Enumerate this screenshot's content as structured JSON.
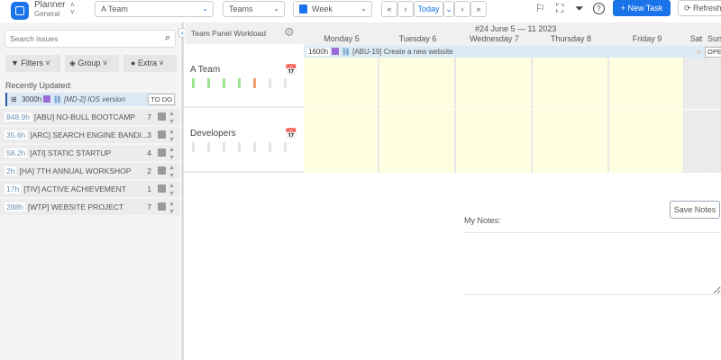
{
  "header": {
    "app_title": "Planner",
    "app_subtitle": "General",
    "team_select": "A Team",
    "view_select": "Teams",
    "period_select": "Week",
    "today_label": "Today",
    "new_task_label": "+ New Task",
    "refresh_label": "Refresh"
  },
  "sidebar": {
    "search_placeholder": "Search issues",
    "filters_label": "Filters",
    "group_label": "Group",
    "extra_label": "Extra",
    "recent_label": "Recently Updated:",
    "recent_item": {
      "hours": "3000h",
      "title": "[MD-2] IOS version",
      "status": "TO DO"
    },
    "projects": [
      {
        "hours": "848.9h",
        "name": "[ABU] NO-BULL BOOTCAMP",
        "count": "7"
      },
      {
        "hours": "35.6h",
        "name": "[ARC] SEARCH ENGINE BANDI...",
        "count": "3"
      },
      {
        "hours": "58.2h",
        "name": "[ATI] STATIC STARTUP",
        "count": "4"
      },
      {
        "hours": "2h",
        "name": "[HA] 7TH ANNUAL WORKSHOP",
        "count": "2"
      },
      {
        "hours": "17h",
        "name": "[TIV] ACTIVE ACHIEVEMENT",
        "count": "1"
      },
      {
        "hours": "288h",
        "name": "[WTP] WEBSITE PROJECT",
        "count": "7"
      }
    ]
  },
  "team_panel": {
    "title": "Team Panel Workload",
    "teams": [
      {
        "name": "A Team",
        "workload": [
          "#9be58f",
          "#9be58f",
          "#9be58f",
          "#9be58f",
          "#f0a070",
          "#e4e4e4",
          "#e4e4e4"
        ]
      },
      {
        "name": "Developers",
        "workload": [
          "#e4e4e4",
          "#e4e4e4",
          "#e4e4e4",
          "#e4e4e4",
          "#e4e4e4",
          "#e4e4e4",
          "#e4e4e4"
        ]
      }
    ]
  },
  "calendar": {
    "week_title": "#24 June 5 — 11 2023",
    "days": [
      "Monday 5",
      "Tuesday 6",
      "Wednesday 7",
      "Thursday 8",
      "Friday 9",
      "Sat",
      "Sun"
    ],
    "task": {
      "hours": "1600h",
      "title": "[ABU-19] Create a new website",
      "status": "OPEN"
    }
  },
  "notes": {
    "label": "My Notes:",
    "save_label": "Save Notes",
    "value": ""
  }
}
